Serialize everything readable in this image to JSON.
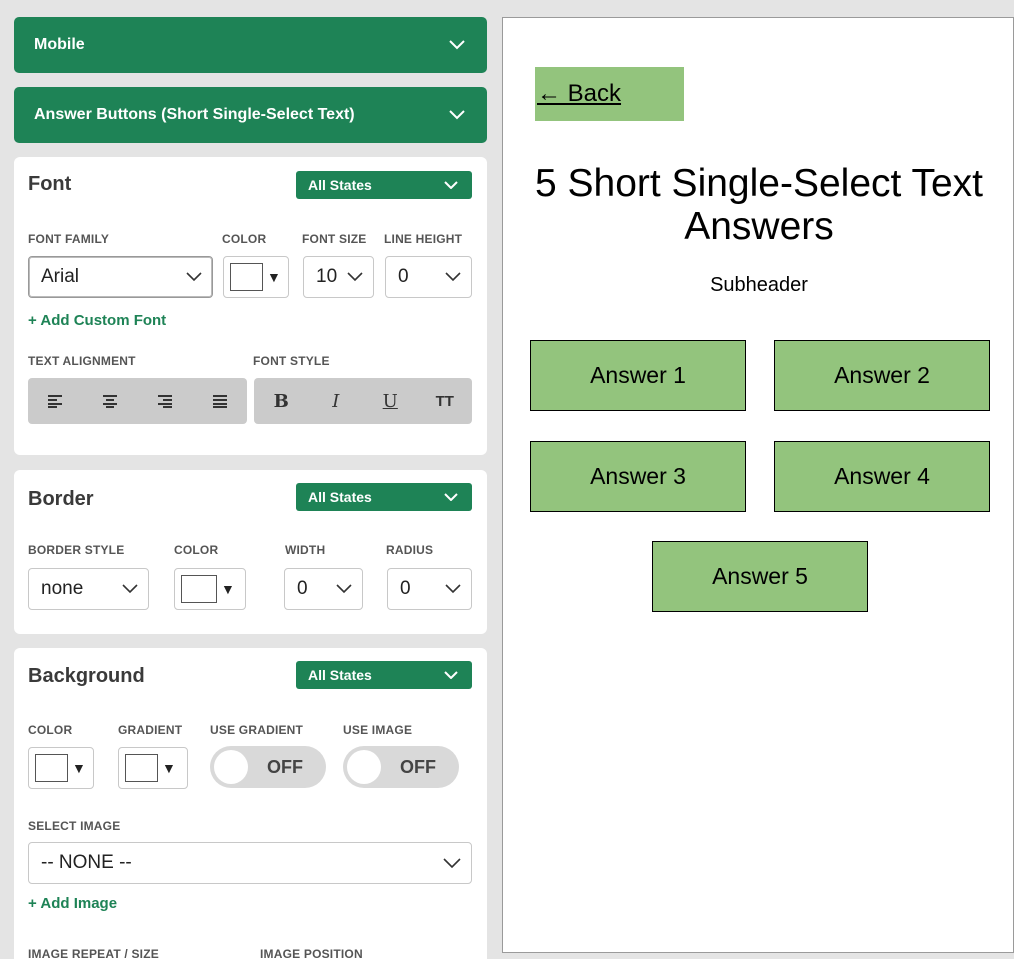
{
  "accordions": {
    "mobile": "Mobile",
    "answer_buttons": "Answer Buttons (Short Single-Select Text)"
  },
  "font_section": {
    "title": "Font",
    "states": "All States",
    "labels": {
      "font_family": "FONT FAMILY",
      "color": "COLOR",
      "font_size": "FONT SIZE",
      "line_height": "LINE HEIGHT",
      "text_alignment": "TEXT ALIGNMENT",
      "font_style": "FONT STYLE"
    },
    "font_family": "Arial",
    "font_size": "10",
    "line_height": "0",
    "add_custom_font": "+ Add Custom Font",
    "style_buttons": {
      "bold": "B",
      "italic": "I",
      "underline": "U",
      "uppercase": "TT"
    }
  },
  "border_section": {
    "title": "Border",
    "states": "All States",
    "labels": {
      "style": "BORDER STYLE",
      "color": "COLOR",
      "width": "WIDTH",
      "radius": "RADIUS"
    },
    "style": "none",
    "width": "0",
    "radius": "0"
  },
  "background_section": {
    "title": "Background",
    "states": "All States",
    "labels": {
      "color": "COLOR",
      "gradient": "GRADIENT",
      "use_gradient": "USE GRADIENT",
      "use_image": "USE IMAGE",
      "select_image": "SELECT IMAGE",
      "image_repeat": "IMAGE REPEAT / SIZE",
      "image_position": "IMAGE POSITION"
    },
    "use_gradient": "OFF",
    "use_image": "OFF",
    "selected_image": "-- NONE --",
    "add_image": "+ Add Image"
  },
  "preview": {
    "back": "← Back",
    "title": "5 Short Single-Select Text Answers",
    "subheader": "Subheader",
    "answers": [
      "Answer 1",
      "Answer 2",
      "Answer 3",
      "Answer 4",
      "Answer 5"
    ]
  },
  "colors": {
    "accent_green": "#1e8356",
    "answer_green": "#93c47d"
  }
}
